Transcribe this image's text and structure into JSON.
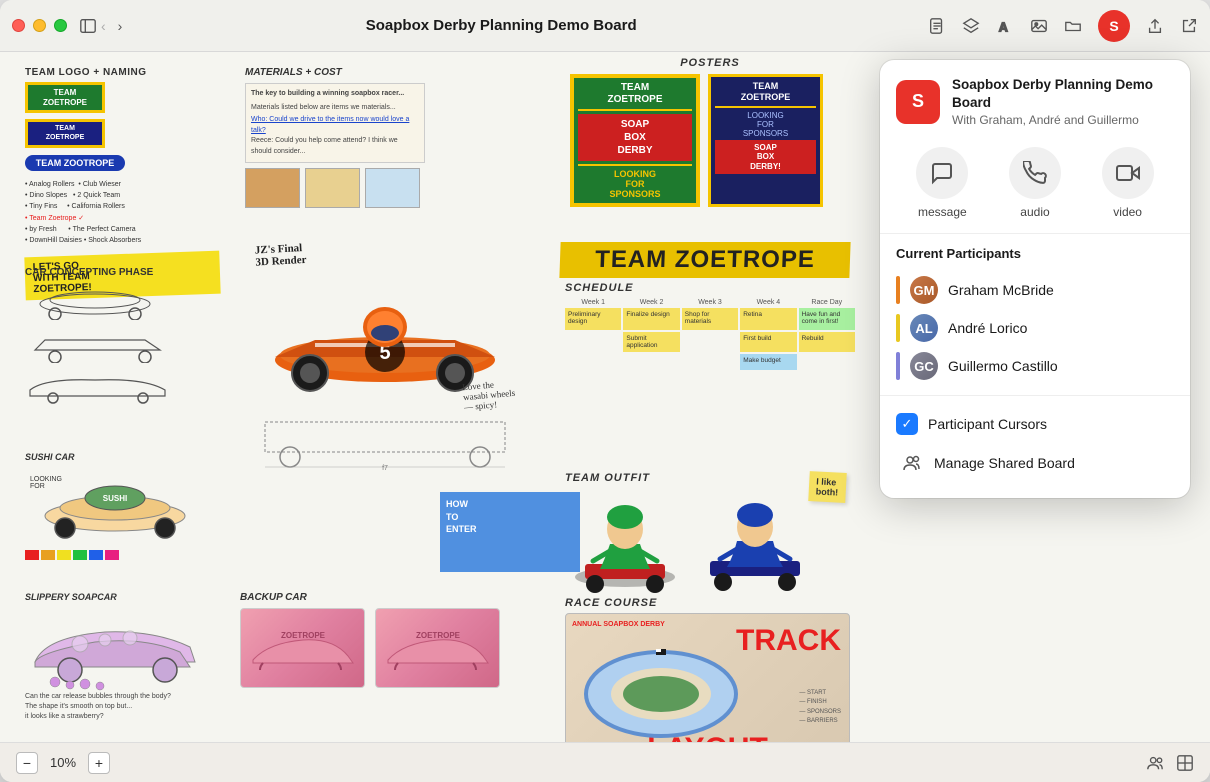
{
  "window": {
    "title": "Soapbox Derby Planning Demo Board"
  },
  "titlebar": {
    "traffic_lights": [
      "red",
      "yellow",
      "green"
    ],
    "back_arrow": "‹",
    "forward_arrow": "›",
    "title": "Soapbox Derby Planning Demo Board"
  },
  "toolbar": {
    "avatar_letter": "S"
  },
  "bottom_bar": {
    "zoom_minus": "−",
    "zoom_level": "10%",
    "zoom_plus": "+"
  },
  "popover": {
    "board_icon_letter": "S",
    "board_name": "Soapbox Derby Planning Demo Board",
    "board_members": "With Graham, André and Guillermo",
    "actions": [
      {
        "id": "message",
        "icon": "💬",
        "label": "message"
      },
      {
        "id": "audio",
        "icon": "📞",
        "label": "audio"
      },
      {
        "id": "video",
        "icon": "🎥",
        "label": "video"
      }
    ],
    "participants_title": "Current Participants",
    "participants": [
      {
        "name": "Graham McBride",
        "color": "#e88020",
        "initials": "GM"
      },
      {
        "name": "André Lorico",
        "color": "#e8c820",
        "initials": "AL"
      },
      {
        "name": "Guillermo Castillo",
        "color": "#8080d8",
        "initials": "GC"
      }
    ],
    "extras": [
      {
        "id": "cursors",
        "label": "Participant Cursors",
        "icon_type": "checkbox_checked"
      },
      {
        "id": "manage-board",
        "label": "Manage Shared Board",
        "icon_type": "manage"
      }
    ]
  },
  "whiteboard": {
    "sections": {
      "team_logo_title": "TEAM LOGO + NAMING",
      "materials_title": "MATERIALS + COST",
      "car_concepting_title": "CAR CONCEPTING PHASE",
      "posters_title": "POSTERS",
      "schedule_title": "SCHEDULE",
      "team_outfit_title": "TEAM OUTFIT",
      "sushi_car_title": "SUSHI CAR",
      "backup_car_title": "BACKUP CAR",
      "race_course_title": "RACE COURSE",
      "slippery_title": "SLIPPERY SOAPCAR",
      "team_zoetrope_text": "TEAM ZOETROPE",
      "yellow_banner": "TEAM ZOETROPE",
      "soapbox_derby": "SOAP BOX DERBY",
      "looking_sponsors": "LOOKING FOR SPONSORS",
      "track_label": "TRACK",
      "layout_label": "LAYOUT",
      "annual_label": "ANNUAL SOAPBOX DERBY"
    }
  }
}
